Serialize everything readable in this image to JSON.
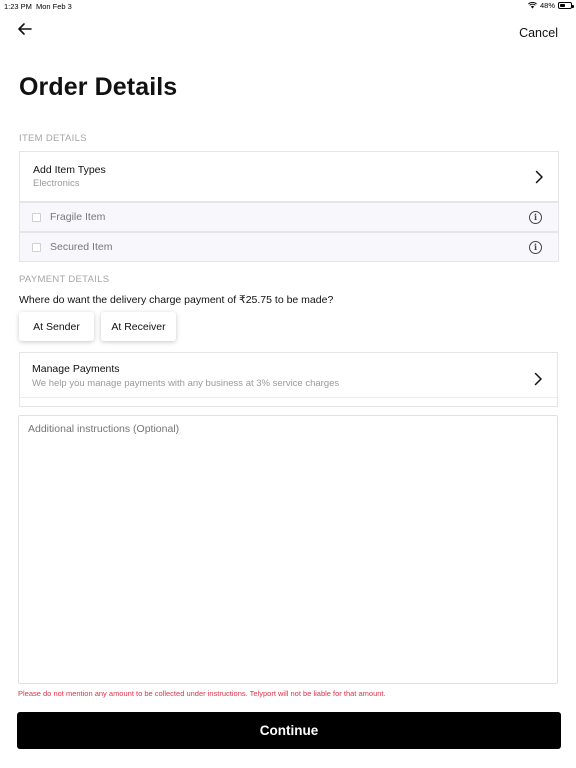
{
  "status_bar": {
    "time": "1:23 PM",
    "date": "Mon Feb 3",
    "battery": "48%",
    "battery_level": 0.48,
    "wifi_icon": "wifi-icon",
    "battery_icon": "battery-icon"
  },
  "header": {
    "back_icon": "arrow-left-icon",
    "cancel_label": "Cancel",
    "title": "Order Details"
  },
  "item_details": {
    "section_label": "ITEM DETAILS",
    "add_item": {
      "title": "Add Item Types",
      "subtitle": "Electronics"
    },
    "options": [
      {
        "label": "Fragile Item",
        "checked": false
      },
      {
        "label": "Secured Item",
        "checked": false
      }
    ]
  },
  "payment_details": {
    "section_label": "PAYMENT DETAILS",
    "question": "Where do want the delivery charge payment of ₹25.75 to be made?",
    "buttons": [
      "At Sender",
      "At Receiver"
    ],
    "manage": {
      "title": "Manage Payments",
      "subtitle": "We help you manage payments with any business at 3% service charges"
    }
  },
  "instructions": {
    "placeholder": "Additional instructions (Optional)"
  },
  "warning": "Please do not mention any amount to be collected under instructions. Telyport will not be liable for that amount.",
  "continue_label": "Continue",
  "colors": {
    "warning": "#e0324b",
    "primary_button": "#000000",
    "row_background": "#f8f8fc"
  }
}
